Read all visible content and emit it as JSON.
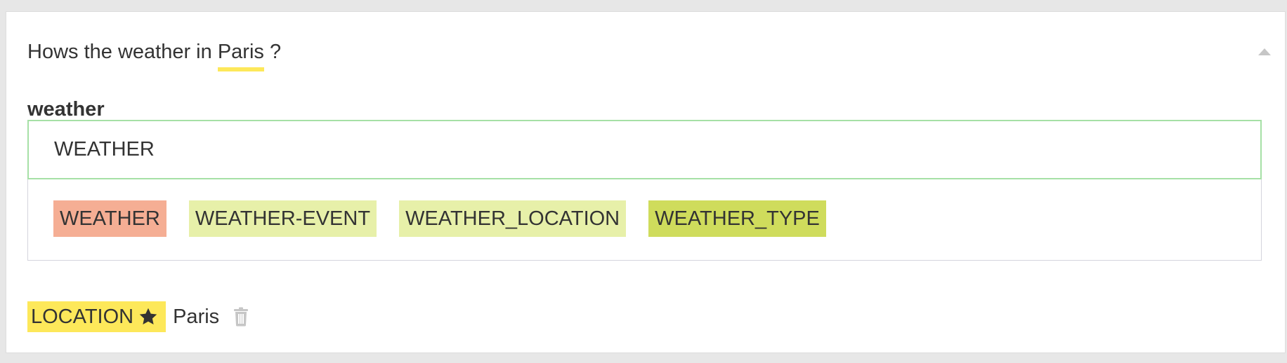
{
  "sentence": {
    "prefix": "Hows the weather in ",
    "entity_text": "Paris",
    "suffix": " ?"
  },
  "intent": {
    "heading": "weather",
    "input_value": "WEATHER"
  },
  "suggestions": [
    {
      "label": "WEATHER",
      "color": "#f5ae94"
    },
    {
      "label": "WEATHER-EVENT",
      "color": "#e7f0a9"
    },
    {
      "label": "WEATHER_LOCATION",
      "color": "#e7f0a9"
    },
    {
      "label": "WEATHER_TYPE",
      "color": "#cfdc5c"
    }
  ],
  "entity": {
    "type_label": "LOCATION",
    "value": "Paris",
    "tag_color": "#fde85a",
    "icons": [
      "star-icon",
      "trash-icon"
    ]
  },
  "colors": {
    "entity_underline": "#fde85a",
    "input_border": "#a6e0a6",
    "icon_gray": "#c6c6c6"
  }
}
